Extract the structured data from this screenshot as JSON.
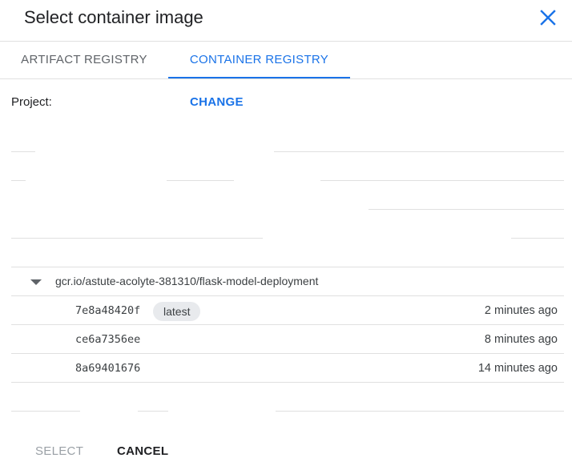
{
  "dialog": {
    "title": "Select container image",
    "close_icon": "close-icon"
  },
  "tabs": [
    {
      "label": "ARTIFACT REGISTRY",
      "active": false
    },
    {
      "label": "CONTAINER REGISTRY",
      "active": true
    }
  ],
  "project": {
    "label": "Project:",
    "change_label": "CHANGE"
  },
  "repository": {
    "name": "gcr.io/astute-acolyte-381310/flask-model-deployment",
    "expanded": true,
    "images": [
      {
        "digest": "7e8a48420f",
        "tag": "latest",
        "time": "2 minutes ago"
      },
      {
        "digest": "ce6a7356ee",
        "tag": "",
        "time": "8 minutes ago"
      },
      {
        "digest": "8a69401676",
        "tag": "",
        "time": "14 minutes ago"
      }
    ]
  },
  "footer": {
    "select_label": "SELECT",
    "cancel_label": "CANCEL"
  },
  "colors": {
    "accent": "#1a73e8",
    "divider": "#e0e0e0",
    "disabled": "#9aa0a6"
  }
}
